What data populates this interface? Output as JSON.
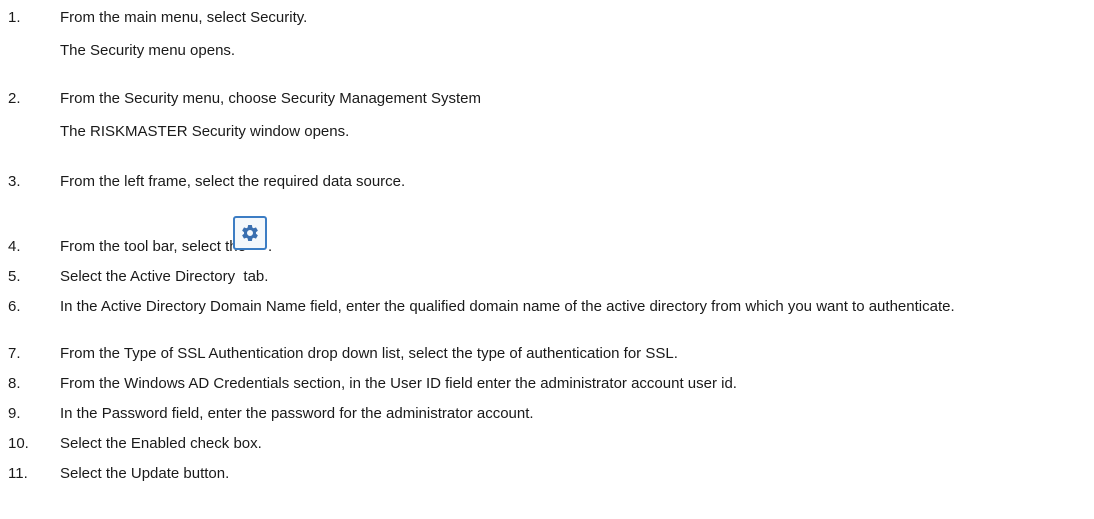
{
  "steps": [
    {
      "num": "1.",
      "text": "From the main menu, select Security.",
      "result": "The Security menu opens."
    },
    {
      "num": "2.",
      "text": "From the Security menu, choose Security Management System",
      "result": "The RISKMASTER Security window opens."
    },
    {
      "num": "3.",
      "text": "From the left frame, select the required data source."
    },
    {
      "num": "4.",
      "text": "From the tool bar, select the",
      "icon": "gear-icon",
      "suffix": "."
    },
    {
      "num": "5.",
      "text": "Select the Active Directory  tab."
    },
    {
      "num": "6.",
      "text": "In the Active Directory Domain Name field, enter the qualified domain name of the active directory from which you want to authenticate."
    },
    {
      "num": "7.",
      "text": "From the Type of SSL Authentication drop down list, select the type of authentication for SSL."
    },
    {
      "num": "8.",
      "text": "From the Windows AD Credentials section, in the User ID field enter the administrator account user id."
    },
    {
      "num": "9.",
      "text": "In the Password field, enter the password for the administrator account."
    },
    {
      "num": "10.",
      "text": "Select the Enabled check box."
    },
    {
      "num": "11.",
      "text": "Select the Update button."
    }
  ],
  "colors": {
    "text": "#1a1a1a",
    "icon_border": "#3c7dc4",
    "icon_fill": "#3a6fb0"
  }
}
